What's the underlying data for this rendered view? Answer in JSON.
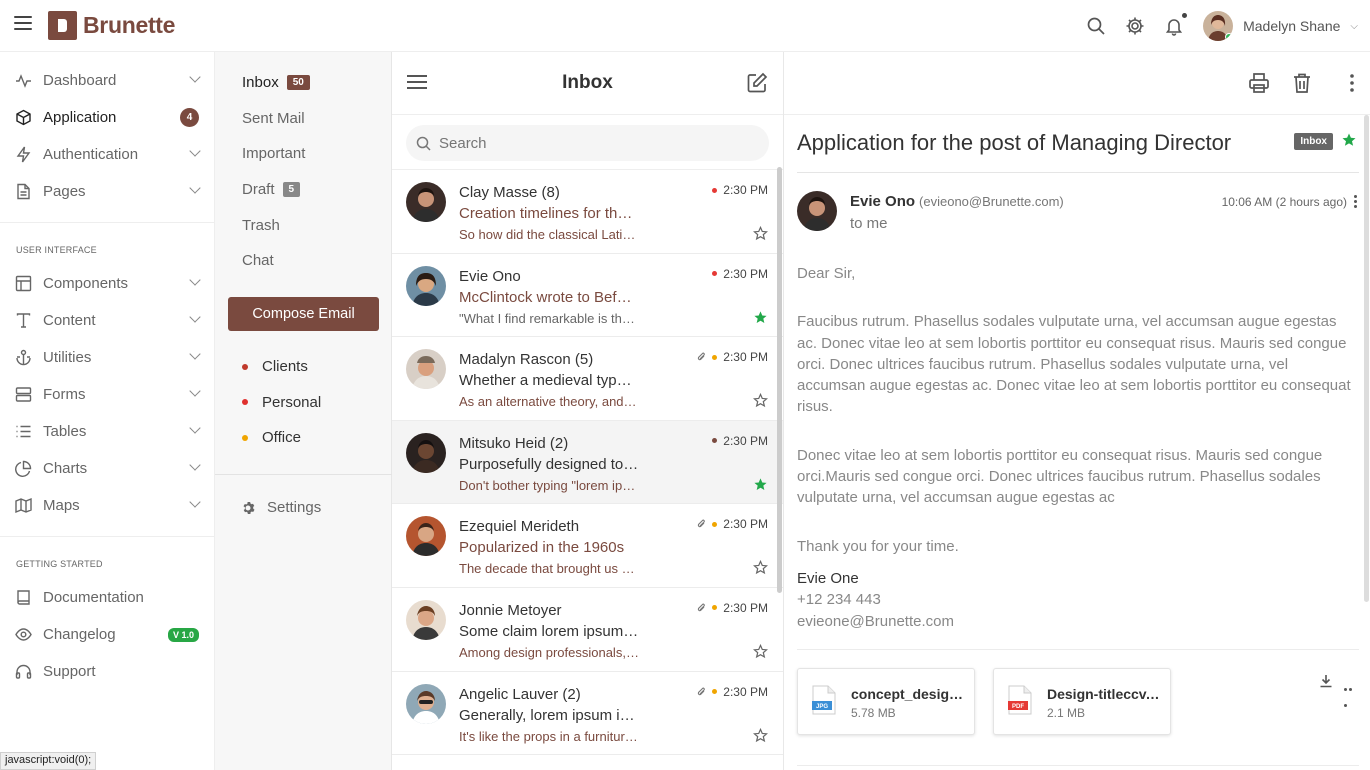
{
  "app": {
    "name": "Brunette"
  },
  "user": {
    "name": "Madelyn Shane"
  },
  "sidebar": {
    "items": [
      {
        "label": "Dashboard"
      },
      {
        "label": "Application",
        "badge": "4"
      },
      {
        "label": "Authentication"
      },
      {
        "label": "Pages"
      }
    ],
    "ui_heading": "USER INTERFACE",
    "ui_items": [
      {
        "label": "Components"
      },
      {
        "label": "Content"
      },
      {
        "label": "Utilities"
      },
      {
        "label": "Forms"
      },
      {
        "label": "Tables"
      },
      {
        "label": "Charts"
      },
      {
        "label": "Maps"
      }
    ],
    "gs_heading": "GETTING STARTED",
    "gs_items": [
      {
        "label": "Documentation"
      },
      {
        "label": "Changelog",
        "badge": "V 1.0"
      },
      {
        "label": "Support"
      }
    ]
  },
  "folders": {
    "items": [
      {
        "label": "Inbox",
        "count": "50"
      },
      {
        "label": "Sent Mail"
      },
      {
        "label": "Important"
      },
      {
        "label": "Draft",
        "count": "5"
      },
      {
        "label": "Trash"
      },
      {
        "label": "Chat"
      }
    ],
    "compose_label": "Compose Email",
    "labels": [
      {
        "label": "Clients",
        "color": "#c0392b"
      },
      {
        "label": "Personal",
        "color": "#e0302e"
      },
      {
        "label": "Office",
        "color": "#f0a500"
      }
    ],
    "settings_label": "Settings"
  },
  "list": {
    "title": "Inbox",
    "search_placeholder": "Search",
    "mails": [
      {
        "from": "Clay Masse (8)",
        "subject": "Creation timelines for the standard lorem ipsum",
        "preview": "So how did the classical Latin become so incoherent?",
        "time": "2:30 PM",
        "dot_color": "#e53935",
        "attachment": false,
        "starred": false,
        "unread": true
      },
      {
        "from": "Evie Ono",
        "subject": "McClintock wrote to Before & After magazine",
        "preview": "\"What I find remarkable is that this text has been",
        "time": "2:30 PM",
        "dot_color": "#e53935",
        "attachment": false,
        "starred": true,
        "unread": true
      },
      {
        "from": "Madalyn Rascon (5)",
        "subject": "Whether a medieval typesetter chose to garble",
        "preview": "As an alternative theory, and because Latin scholars",
        "time": "2:30 PM",
        "dot_color": "#f0a500",
        "attachment": true,
        "starred": false,
        "unread": false
      },
      {
        "from": "Mitsuko Heid (2)",
        "subject": "Purposefully designed to have no meaning",
        "preview": "Don't bother typing \"lorem ipsum\" into Google",
        "time": "2:30 PM",
        "dot_color": "#7a4a3f",
        "attachment": false,
        "starred": true,
        "unread": false
      },
      {
        "from": "Ezequiel Merideth",
        "subject": "Popularized in the 1960s",
        "preview": "The decade that brought us Star Trek and Woodstock",
        "time": "2:30 PM",
        "dot_color": "#f0a500",
        "attachment": true,
        "starred": false,
        "unread": true
      },
      {
        "from": "Jonnie Metoyer",
        "subject": "Some claim lorem ipsum threatens to promote",
        "preview": "Among design professionals, there's a bit of",
        "time": "2:30 PM",
        "dot_color": "#f0a500",
        "attachment": true,
        "starred": false,
        "unread": false
      },
      {
        "from": "Angelic Lauver (2)",
        "subject": "Generally, lorem ipsum is best suited to keep",
        "preview": "It's like the props in a furniture store",
        "time": "2:30 PM",
        "dot_color": "#f0a500",
        "attachment": true,
        "starred": false,
        "unread": false
      }
    ]
  },
  "reader": {
    "title": "Application for the post of Managing Director",
    "badge": "Inbox",
    "from_name": "Evie Ono",
    "from_email": "(evieono@Brunette.com)",
    "to": "to me",
    "time": "10:06 AM (2 hours ago)",
    "greeting": "Dear Sir,",
    "para1": "Faucibus rutrum. Phasellus sodales vulputate urna, vel accumsan augue egestas ac. Donec vitae leo at sem lobortis porttitor eu consequat risus. Mauris sed congue orci. Donec ultrices faucibus rutrum. Phasellus sodales vulputate urna, vel accumsan augue egestas ac. Donec vitae leo at sem lobortis porttitor eu consequat risus.",
    "para2": "Donec vitae leo at sem lobortis porttitor eu consequat risus. Mauris sed congue orci.Mauris sed congue orci. Donec ultrices faucibus rutrum. Phasellus sodales vulputate urna, vel accumsan augue egestas ac",
    "thanks": "Thank you for your time.",
    "sig_name": "Evie One",
    "sig_phone": "+12 234 443",
    "sig_email": "evieone@Brunette.com",
    "attachments": [
      {
        "name": "concept_design.jpg",
        "size": "5.78 MB",
        "type": "JPG",
        "color": "#3b8fd6"
      },
      {
        "name": "Design-titleccv.pdf",
        "size": "2.1 MB",
        "type": "PDF",
        "color": "#e53935"
      }
    ]
  },
  "status_bar": "javascript:void(0);"
}
